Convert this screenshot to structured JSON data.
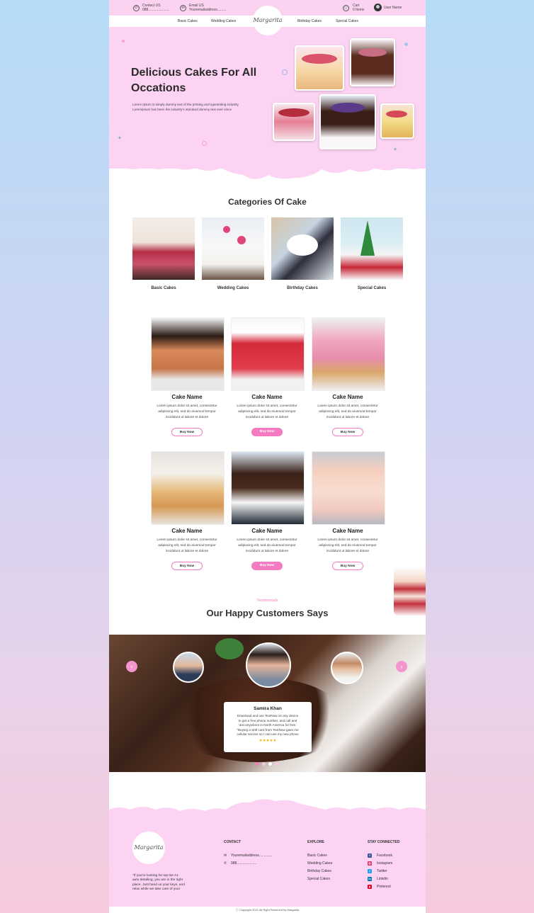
{
  "topbar": {
    "contact_label": "Contact US",
    "contact_value": "088.....................",
    "email_label": "Email US",
    "email_value": "Youremailaddress.........",
    "cart_label": "Cart",
    "cart_value": "0 Items",
    "user_label": "User Name"
  },
  "nav": {
    "items": [
      "Basic Cakes",
      "Wedding Cakes",
      "Birthday Cakes",
      "Special Cakes"
    ],
    "logo": "Margarita"
  },
  "hero": {
    "title_line1": "Delicious Cakes For All",
    "title_line2": "Occations",
    "desc_line1": "Lorem Ipsum is simply dummy text of the printing and typesetting industry.",
    "desc_line2": "Loremipsum has been the industry's standard dummy text ever since"
  },
  "categories": {
    "heading": "Categories Of Cake",
    "items": [
      "Basic Cakes",
      "Wedding Cakes",
      "Birthday Cakes",
      "Special Cakes"
    ]
  },
  "products": {
    "items": [
      {
        "name": "Cake Name",
        "desc1": "Lorem ipsum dolor sit amet, consectetur",
        "desc2": "adipiscing elit, sed do eiusmod tempor",
        "desc3": "incididunt ut labore et dolore",
        "button": "Buy Now"
      },
      {
        "name": "Cake Name",
        "desc1": "Lorem ipsum dolor sit amet, consectetur",
        "desc2": "adipiscing elit, sed do eiusmod tempor",
        "desc3": "incididunt ut labore et dolore",
        "button": "Buy Now"
      },
      {
        "name": "Cake Name",
        "desc1": "Lorem ipsum dolor sit amet, consectetur",
        "desc2": "adipiscing elit, sed do eiusmod tempor",
        "desc3": "incididunt ut labore et dolore",
        "button": "Buy Now"
      },
      {
        "name": "Cake Name",
        "desc1": "Lorem ipsum dolor sit amet, consectetur",
        "desc2": "adipiscing elit, sed do eiusmod tempor",
        "desc3": "incididunt ut labore et dolore",
        "button": "Buy Now"
      },
      {
        "name": "Cake Name",
        "desc1": "Lorem ipsum dolor sit amet, consectetur",
        "desc2": "adipiscing elit, sed do eiusmod tempor",
        "desc3": "incididunt ut labore et dolore",
        "button": "Buy Now"
      },
      {
        "name": "Cake Name",
        "desc1": "Lorem ipsum dolor sit amet, consectetur",
        "desc2": "adipiscing elit, sed do eiusmod tempor",
        "desc3": "incididunt ut labore et dolore",
        "button": "Buy Now"
      }
    ]
  },
  "testimonials": {
    "eyebrow": "Testimonials",
    "heading": "Our Happy Customers Says",
    "name": "Samira Khan",
    "quote_lines": [
      "Download and use TextNow on any device",
      "to get a free phone number, and call and",
      "text anywhere in North America for free.",
      "\"Buying a SIM card from TextNow gave me",
      "cellular service so I can use my new phone"
    ],
    "stars": "★★★★★",
    "prev": "‹",
    "next": "›"
  },
  "footer": {
    "logo": "Margarita",
    "about_lines": [
      "\"If you're looking for top tier A1",
      "auto detailing, you are in the right",
      "place. Just hand us your keys, and",
      "relax while we take care of your"
    ],
    "contact_heading": "CONTACT",
    "contact_email": "Youremailaddress.............",
    "contact_phone": "088....................",
    "explore_heading": "EXPLORE",
    "explore_items": [
      "Basic Cakes",
      "Wedding Cakes",
      "Birthday Cakes",
      "Special Cakes"
    ],
    "social_heading": "STAY CONNECTED",
    "social_items": [
      "Facebook",
      "Instagram",
      "Twitter",
      "Linkdin",
      "Pinterest"
    ],
    "copyright": "Copyright 2021 All Right Reserved by Margarita"
  },
  "colors": {
    "pink_bg": "#fcd3f2",
    "accent": "#f47ac2",
    "facebook": "#3b5998",
    "instagram": "#e1306c",
    "twitter": "#1da1f2",
    "linkedin": "#0077b5",
    "pinterest": "#e60023"
  }
}
